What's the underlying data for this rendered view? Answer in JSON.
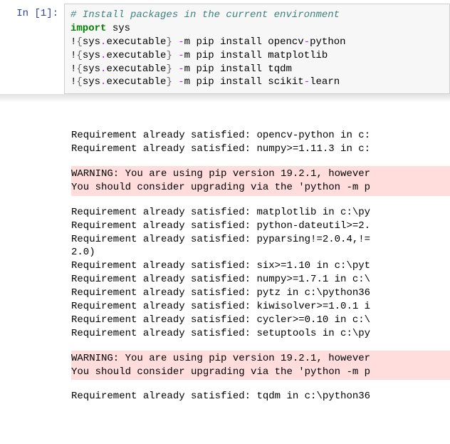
{
  "cell": {
    "prompt": "In [1]:",
    "code": {
      "comment": "# Install packages in the current environment",
      "import_kw": "import",
      "import_mod": " sys",
      "bang": "!",
      "obrace": "{",
      "cbrace": "}",
      "sys": "sys",
      "dot": ".",
      "exe": "executable",
      "dash": "-",
      "m": "m pip install ",
      "pkg1a": "opencv",
      "pkg1b": "python",
      "pkg2": "matplotlib",
      "pkg3": "tqdm",
      "pkg4a": "scikit",
      "pkg4b": "learn"
    }
  },
  "output": {
    "pre1": [
      "Requirement already satisfied: opencv-python in c:",
      "Requirement already satisfied: numpy>=1.11.3 in c:"
    ],
    "warn1": [
      "WARNING: You are using pip version 19.2.1, however",
      "You should consider upgrading via the 'python -m p"
    ],
    "mid": [
      "Requirement already satisfied: matplotlib in c:\\py",
      "Requirement already satisfied: python-dateutil>=2.",
      "Requirement already satisfied: pyparsing!=2.0.4,!=",
      "2.0)",
      "Requirement already satisfied: six>=1.10 in c:\\pyt",
      "Requirement already satisfied: numpy>=1.7.1 in c:\\",
      "Requirement already satisfied: pytz in c:\\python36",
      "Requirement already satisfied: kiwisolver>=1.0.1 i",
      "Requirement already satisfied: cycler>=0.10 in c:\\",
      "Requirement already satisfied: setuptools in c:\\py"
    ],
    "warn2": [
      "WARNING: You are using pip version 19.2.1, however",
      "You should consider upgrading via the 'python -m p"
    ],
    "tail": [
      "Requirement already satisfied: tqdm in c:\\python36"
    ]
  }
}
